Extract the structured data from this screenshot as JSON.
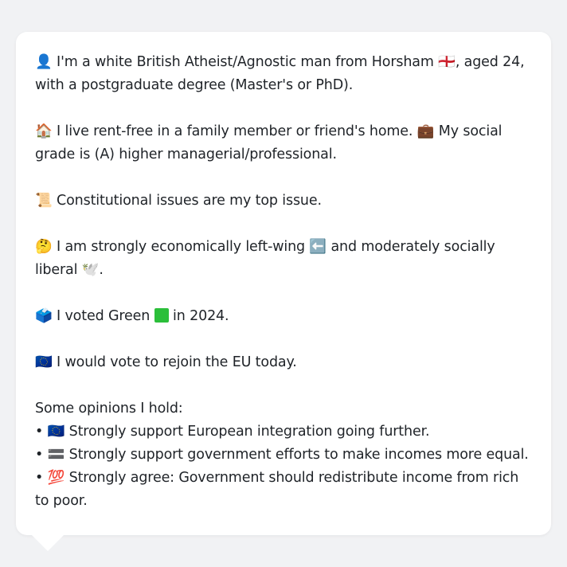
{
  "profile": {
    "p1": "👤 I'm a white British Atheist/Agnostic man from Horsham 🏴󠁧󠁢󠁥󠁮󠁧󠁿, aged 24, with a postgraduate degree (Master's or PhD).",
    "p2": "🏠 I live rent-free in a family member or friend's home. 💼 My social grade is (A) higher managerial/professional.",
    "p3": "📜 Constitutional issues are my top issue.",
    "p4": "🤔 I am strongly economically left-wing ⬅️ and moderately socially liberal 🕊️.",
    "p5_prefix": "🗳️ I voted Green",
    "p5_suffix": "in 2024.",
    "p6": "🇪🇺 I would vote to rejoin the EU today."
  },
  "opinions": {
    "heading": "Some opinions I hold:",
    "items": [
      "• 🇪🇺 Strongly support European integration going further.",
      "• 🟰 Strongly support government efforts to make incomes more equal.",
      "• 💯 Strongly agree: Government should redistribute income from rich to poor."
    ]
  },
  "colors": {
    "background": "#f1f2f4",
    "card": "#ffffff",
    "text": "#1f2328",
    "green_square": "#2bbf3a"
  }
}
